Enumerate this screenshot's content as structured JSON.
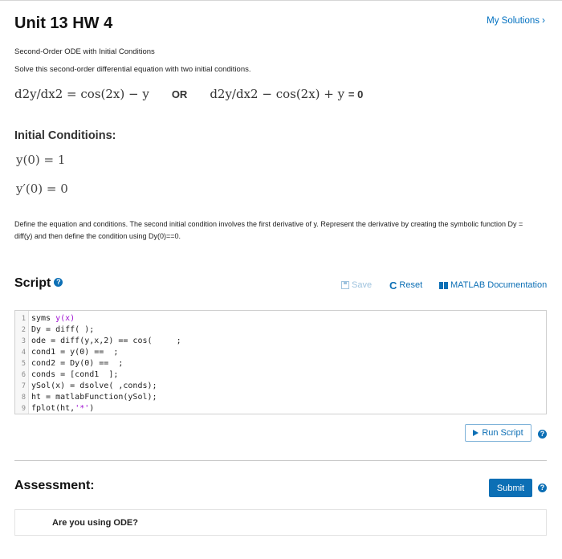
{
  "header": {
    "title": "Unit 13 HW 4",
    "my_solutions": "My Solutions",
    "chevron": "›"
  },
  "problem": {
    "subtitle": "Second-Order ODE with Initial Conditions",
    "instruction": "Solve this second-order differential equation with two initial conditions.",
    "eq1": "d2y/dx2 = cos(2x) − y",
    "or": "OR",
    "eq2": "d2y/dx2 − cos(2x) + y",
    "eq2_rhs": "= 0",
    "ic_heading": "Initial Conditioins:",
    "ic1": "y(0) = 1",
    "ic2": "y′(0) = 0",
    "define_text": "Define the equation and conditions. The second initial condition involves  the first derivative of y. Represent the derivative by creating the symbolic function Dy = diff(y) and then define the condition using Dy(0)==0."
  },
  "script": {
    "title": "Script",
    "help_glyph": "?",
    "save_label": "Save",
    "reset_label": "Reset",
    "reset_glyph": "C",
    "doc_label": "MATLAB Documentation",
    "run_label": "Run Script"
  },
  "code_lines": [
    {
      "n": "1",
      "a": "syms ",
      "s": "y(x)",
      "b": ""
    },
    {
      "n": "2",
      "a": "Dy = diff( );",
      "s": "",
      "b": ""
    },
    {
      "n": "3",
      "a": "ode = diff(y,x,2) == cos(     ;",
      "s": "",
      "b": ""
    },
    {
      "n": "4",
      "a": "cond1 = y(0) ==  ;",
      "s": "",
      "b": ""
    },
    {
      "n": "5",
      "a": "cond2 = Dy(0) ==  ;",
      "s": "",
      "b": ""
    },
    {
      "n": "6",
      "a": "conds = [cond1  ];",
      "s": "",
      "b": ""
    },
    {
      "n": "7",
      "a": "ySol(x) = dsolve( ,conds);",
      "s": "",
      "b": ""
    },
    {
      "n": "8",
      "a": "ht = matlabFunction(ySol);",
      "s": "",
      "b": ""
    },
    {
      "n": "9",
      "a": "fplot(ht,",
      "s": "'*'",
      "b": ")"
    }
  ],
  "assessment": {
    "title": "Assessment:",
    "submit_label": "Submit",
    "question": "Are you using ODE?"
  },
  "colors": {
    "accent": "#0c6fb5",
    "string": "#a013d1",
    "link": "#0070c0"
  }
}
